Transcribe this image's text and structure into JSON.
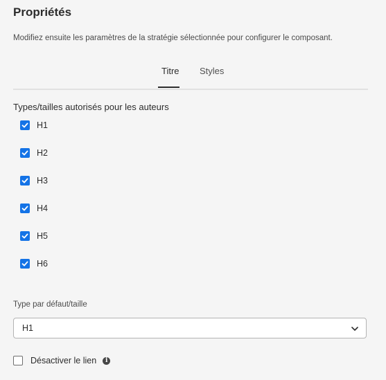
{
  "panel": {
    "title": "Propriétés",
    "description": "Modifiez ensuite les paramètres de la stratégie sélectionnée pour configurer le composant."
  },
  "tabs": [
    {
      "label": "Titre",
      "active": true
    },
    {
      "label": "Styles",
      "active": false
    }
  ],
  "allowed_types": {
    "label": "Types/tailles autorisés pour les auteurs",
    "items": [
      {
        "label": "H1",
        "checked": true
      },
      {
        "label": "H2",
        "checked": true
      },
      {
        "label": "H3",
        "checked": true
      },
      {
        "label": "H4",
        "checked": true
      },
      {
        "label": "H5",
        "checked": true
      },
      {
        "label": "H6",
        "checked": true
      }
    ]
  },
  "default_type": {
    "label": "Type par défaut/taille",
    "value": "H1",
    "icon": "chevron-down-icon"
  },
  "disable_link": {
    "label": "Désactiver le lien",
    "checked": false,
    "icon": "info-icon"
  },
  "colors": {
    "accent": "#1473e6",
    "background": "#f5f5f5"
  }
}
